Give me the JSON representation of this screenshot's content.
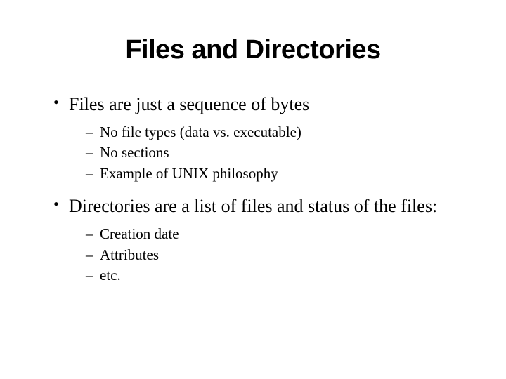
{
  "title": "Files and Directories",
  "bullets": [
    {
      "text": "Files are just a sequence of bytes",
      "sub": [
        "No file types (data vs. executable)",
        "No sections",
        "Example of UNIX philosophy"
      ]
    },
    {
      "text": "Directories are a list of files and status of the files:",
      "sub": [
        "Creation date",
        "Attributes",
        "etc."
      ]
    }
  ]
}
